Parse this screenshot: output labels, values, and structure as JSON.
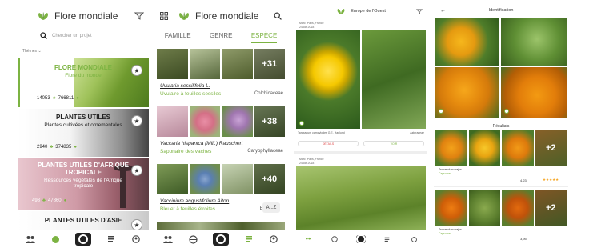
{
  "colors": {
    "accent": "#7cb342",
    "dark": "#222222",
    "star": "#f5a623"
  },
  "screen1": {
    "title": "Flore mondiale",
    "search_placeholder": "Chercher un projet",
    "themes_label": "Thèmes",
    "cards": [
      {
        "title": "FLORE MONDIALE",
        "subtitle": "Flore du monde",
        "species": "14053",
        "observations": "766811"
      },
      {
        "title": "PLANTES UTILES",
        "subtitle": "Plantes cultivées et ornementales",
        "species": "2940",
        "observations": "374835"
      },
      {
        "title": "PLANTES UTILES D'AFRIQUE TROPICALE",
        "subtitle": "Ressources végétales de l'Afrique tropicale",
        "species": "498",
        "observations": "47860"
      },
      {
        "title": "PLANTES UTILES D'ASIE"
      }
    ]
  },
  "screen2": {
    "title": "Flore mondiale",
    "tabs": [
      "FAMILLE",
      "GENRE",
      "ESPÈCE"
    ],
    "species": [
      {
        "more": "+31",
        "name": "Uvularia sessilifolia L.",
        "common": "Uvulaire à feuilles sessiles",
        "family": "Colchicaceae"
      },
      {
        "more": "+38",
        "name": "Vaccaria hispanica (Mill.) Rauschert",
        "common": "Saponaire des vaches",
        "family": "Caryophyllaceae"
      },
      {
        "more": "+40",
        "name": "Vaccinium angustifolium Aiton",
        "common": "Bleuet à feuilles étroites",
        "family": "Eri"
      }
    ],
    "az_label": "A...Z"
  },
  "screen3": {
    "title": "Europe de l'Ouest",
    "obs1": {
      "user": "Marc",
      "date": "24 oct 2018",
      "place": "Paris, France",
      "caption": "Taraxacum campylodes G.E. Haglund",
      "tag": "Asteraceae"
    },
    "obs1_buttons": [
      "DÉTAILS",
      "VOIR"
    ],
    "obs2": {
      "user": "Marc",
      "date": "24 oct 2018",
      "place": "Paris, France"
    }
  },
  "screen4": {
    "title": "Identification",
    "results_label": "Résultats",
    "results": [
      {
        "more": "+2",
        "name": "Tropaeolum majus L.",
        "common": "Capucine",
        "score": "4,23",
        "rating": "★★★★★"
      },
      {
        "more": "+2",
        "name": "Tropaeolum majus L.",
        "common": "Capucine",
        "score": "3,95",
        "rating": ""
      }
    ]
  }
}
